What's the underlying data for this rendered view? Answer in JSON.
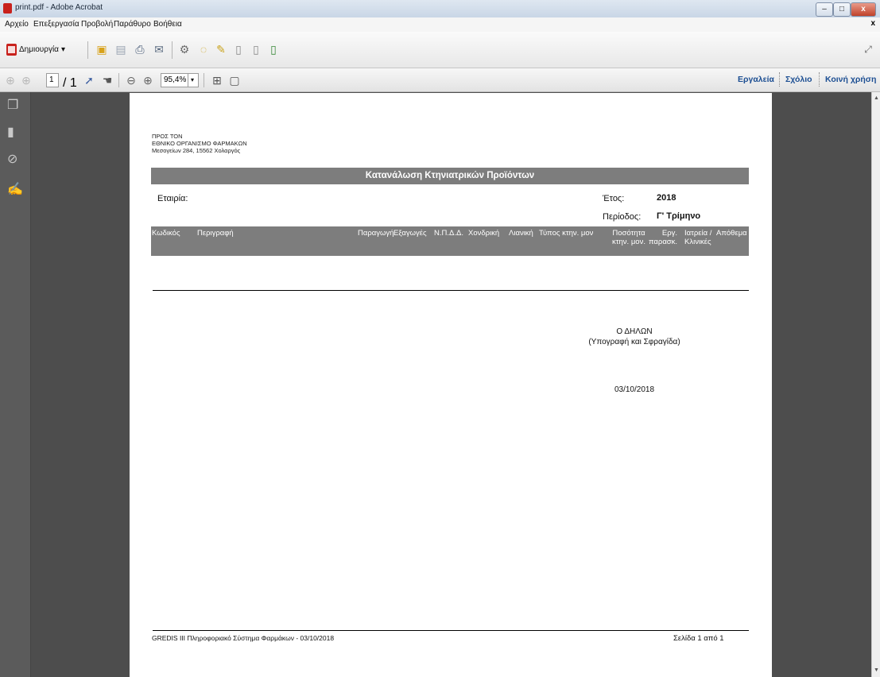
{
  "window": {
    "title": "print.pdf - Adobe Acrobat",
    "min": "–",
    "max": "□",
    "close": "x"
  },
  "menu": {
    "items": [
      "Αρχείο",
      "Επεξεργασία",
      "Προβολή",
      "Παράθυρο",
      "Βοήθεια"
    ],
    "close": "x"
  },
  "toolbar": {
    "create_label": "Δημιουργία",
    "create_arrow": "▾"
  },
  "nav": {
    "page_current": "1",
    "page_total": "/ 1",
    "zoom": "95,4%",
    "zoom_arrow": "▾",
    "tools": "Εργαλεία",
    "comment": "Σχόλιο",
    "share": "Κοινή χρήση"
  },
  "document": {
    "recipient": [
      "ΠΡΟΣ ΤΟΝ",
      "ΕΘΝΙΚΟ ΟΡΓΑΝΙΣΜΟ ΦΑΡΜΑΚΩΝ",
      "Μεσογείων 284, 15562 Χολαργός"
    ],
    "heading": "Κατανάλωση Κτηνιατρικών Προϊόντων",
    "company_label": "Εταιρία:",
    "year_label": "Έτος:",
    "year_value": "2018",
    "period_label": "Περίοδος:",
    "period_value": "Γ' Τρίμηνο",
    "columns": {
      "code": "Κωδικός",
      "description": "Περιγραφή",
      "production": "Παραγωγή",
      "exports": "Εξαγωγές",
      "npdd": "Ν.Π.Δ.Δ.",
      "wholesale": "Χονδρική",
      "retail": "Λιανική",
      "unit_type": "Τύπος κτην. μον",
      "quantity_1": "Ποσότητα",
      "quantity_2": "κτην. μον.",
      "erg_1": "Εργ.",
      "erg_2": "παρασκ.",
      "clinics_1": "Ιατρεία /",
      "clinics_2": "Κλινικές",
      "stock": "Απόθεμα"
    },
    "declarant": "Ο ΔΗΛΩΝ",
    "signature_note": "(Υπογραφή και Σφραγίδα)",
    "date": "03/10/2018",
    "footer_left": "GREDIS III Πληροφοριακό Σύστημα Φαρμάκων - 03/10/2018",
    "footer_right": "Σελίδα 1 από 1"
  }
}
